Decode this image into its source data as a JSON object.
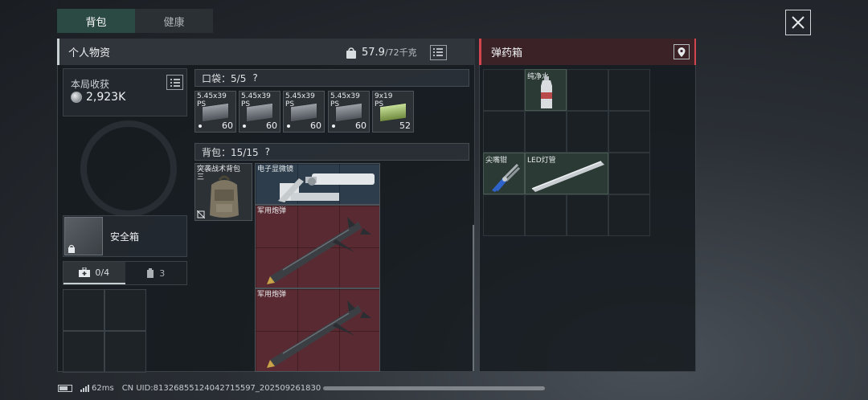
{
  "tabs": [
    {
      "label": "背包",
      "active": true
    },
    {
      "label": "健康",
      "active": false
    }
  ],
  "left_panel": {
    "title": "个人物资",
    "weight_current": "57.9",
    "weight_max": "/72千克"
  },
  "right_panel": {
    "title": "弹药箱",
    "items": [
      {
        "label": "纯净水",
        "icon": "water-bottle-icon"
      },
      {
        "label": "尖嘴钳",
        "icon": "pliers-icon"
      },
      {
        "label": "LED灯管",
        "icon": "led-tube-icon"
      }
    ]
  },
  "earnings": {
    "label": "本局收获",
    "value": "2,923K"
  },
  "safe_box": {
    "label": "安全箱"
  },
  "subtabs": [
    {
      "label": "0/4",
      "icon": "medkit-icon",
      "active": true
    },
    {
      "label": "3",
      "icon": "canister-icon",
      "active": false
    }
  ],
  "pocket": {
    "label": "口袋：",
    "count": "5/5",
    "help": "?",
    "items": [
      {
        "label_line1": "5.45x39",
        "label_line2": "PS",
        "count": "60"
      },
      {
        "label_line1": "5.45x39",
        "label_line2": "PS",
        "count": "60"
      },
      {
        "label_line1": "5.45x39",
        "label_line2": "PS",
        "count": "60"
      },
      {
        "label_line1": "5.45x39",
        "label_line2": "PS",
        "count": "60"
      },
      {
        "label_line1": "9x19",
        "label_line2": "PS",
        "count": "52"
      }
    ]
  },
  "backpack": {
    "label": "背包：",
    "count": "15/15",
    "help": "?",
    "items": [
      {
        "label_line1": "突袭战术背包",
        "label_line2": "三"
      },
      {
        "label_line1": "电子显微镜"
      },
      {
        "label_line1": "军用炮弹"
      },
      {
        "label_line1": "军用炮弹"
      }
    ]
  },
  "footer": {
    "ping": "62ms",
    "uid": "CN UID:81326855124042715597_202509261830"
  },
  "colors": {
    "accent_red": "#d2444e",
    "tab_active": "#2c4a44",
    "item_red": "#5a2a32"
  }
}
